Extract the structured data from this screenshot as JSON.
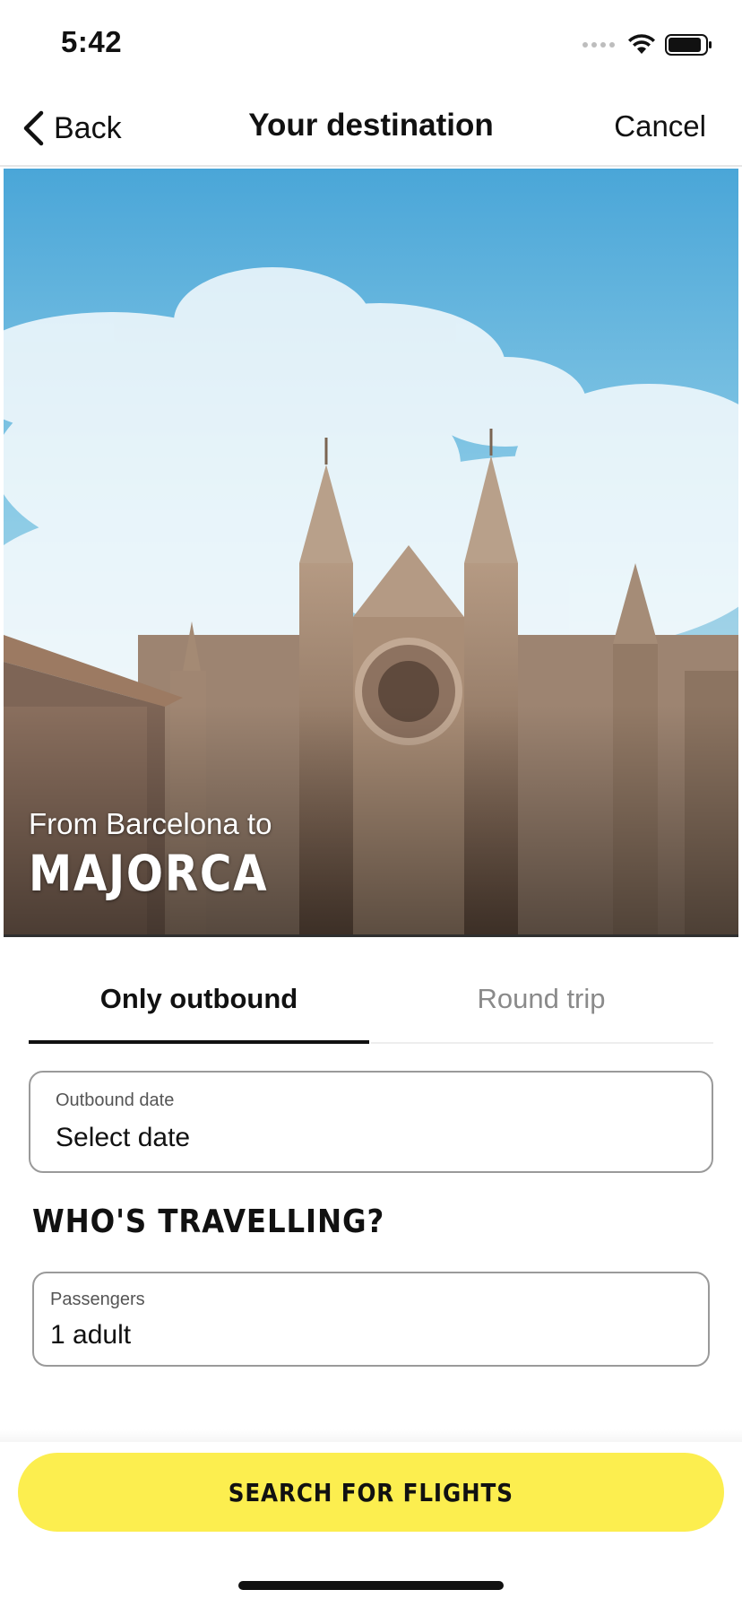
{
  "status_bar": {
    "time": "5:42"
  },
  "nav": {
    "back_label": "Back",
    "title": "Your destination",
    "cancel_label": "Cancel"
  },
  "hero": {
    "subtitle": "From Barcelona to",
    "city": "MAJORCA"
  },
  "tabs": [
    {
      "label": "Only outbound",
      "active": true
    },
    {
      "label": "Round trip",
      "active": false
    }
  ],
  "outbound_field": {
    "label": "Outbound date",
    "value": "Select date"
  },
  "travellers": {
    "title": "WHO'S TRAVELLING?",
    "label": "Passengers",
    "value": "1 adult"
  },
  "search_button": {
    "label": "SEARCH FOR FLIGHTS"
  },
  "colors": {
    "accent": "#fcee4f",
    "sky_top": "#4fa9d9",
    "stone": "#9a7c64"
  }
}
